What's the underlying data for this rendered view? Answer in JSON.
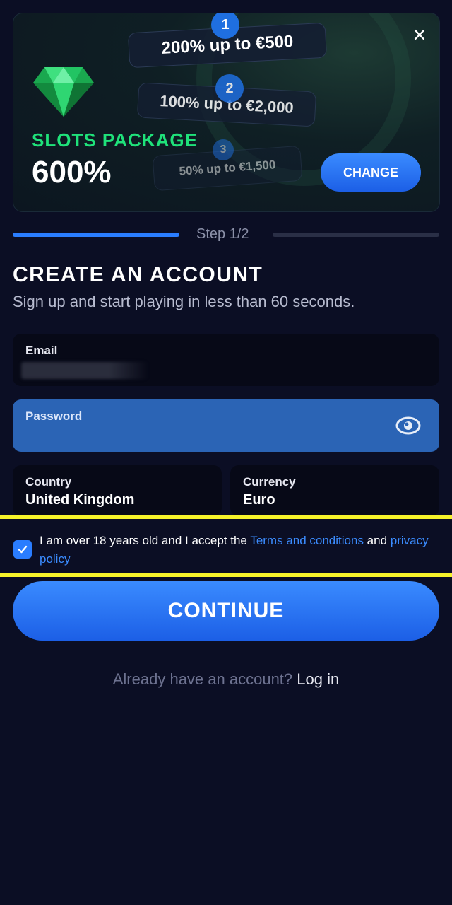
{
  "banner": {
    "offers": [
      {
        "step": "1",
        "text": "200% up to €500"
      },
      {
        "step": "2",
        "text": "100% up to €2,000"
      },
      {
        "step": "3",
        "text": "50% up to €1,500"
      }
    ],
    "package_name": "SLOTS PACKAGE",
    "package_percent": "600%",
    "change_label": "CHANGE",
    "close_icon": "×",
    "gem_color": "#1fe27a"
  },
  "progress": {
    "step_label": "Step 1/2",
    "active_color": "#2a7dff"
  },
  "form": {
    "title": "CREATE AN ACCOUNT",
    "subtitle": "Sign up and start playing in less than 60 seconds.",
    "email": {
      "label": "Email",
      "value": ""
    },
    "password": {
      "label": "Password",
      "value": ""
    },
    "country": {
      "label": "Country",
      "value": "United Kingdom"
    },
    "currency": {
      "label": "Currency",
      "value": "Euro"
    },
    "terms": {
      "checked": true,
      "text_before": "I am over 18 years old and I accept the ",
      "terms_link": "Terms and conditions",
      "text_middle": " and ",
      "privacy_link": "privacy policy"
    },
    "continue_label": "CONTINUE",
    "login_prompt": "Already have an account?",
    "login_link": "Log in"
  },
  "colors": {
    "accent": "#2a7dff",
    "background": "#0b0e24",
    "highlight": "#f6f32a",
    "package_green": "#1fe27a"
  }
}
